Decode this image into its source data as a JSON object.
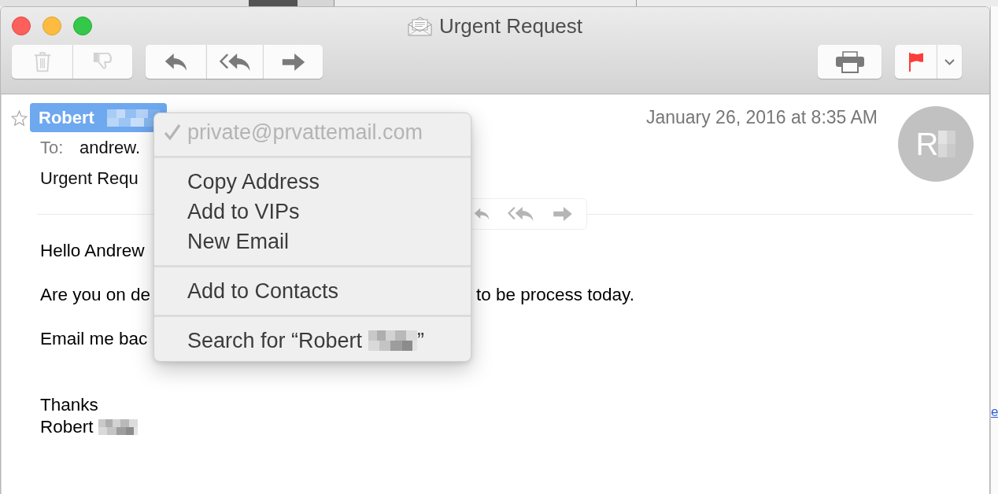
{
  "window": {
    "title": "Urgent Request"
  },
  "toolbar": {
    "left": [
      {
        "buttons": [
          {
            "kind": "trash",
            "disabled": true
          },
          {
            "kind": "junk",
            "disabled": true
          }
        ]
      },
      {
        "buttons": [
          {
            "kind": "reply",
            "disabled": false
          },
          {
            "kind": "reply_all",
            "disabled": false
          },
          {
            "kind": "forward",
            "disabled": false
          }
        ]
      }
    ],
    "right": [
      {
        "buttons": [
          {
            "kind": "print",
            "disabled": false
          }
        ]
      },
      {
        "buttons": [
          {
            "kind": "flag",
            "disabled": false
          },
          {
            "kind": "menu",
            "disabled": false
          }
        ]
      }
    ]
  },
  "message": {
    "sender": {
      "name": "Robert",
      "redacted": true,
      "selected": true,
      "vip": false
    },
    "date": "January 26, 2016 at 8:35 AM",
    "to_label": "To:",
    "to": "andrew.",
    "subject": "Urgent Requ",
    "avatar": {
      "initial": "R",
      "redacted": true
    },
    "quick_actions": [
      {
        "kind": "reply"
      },
      {
        "kind": "reply_all"
      },
      {
        "kind": "forward"
      }
    ],
    "body": [
      {
        "text": "Hello Andrew"
      },
      {
        "text": "Are you on de",
        "text_after": "to be process today."
      },
      {
        "text": "Email me bac"
      }
    ],
    "closing": "Thanks",
    "signature": {
      "name": "Robert",
      "redacted": true
    }
  },
  "context_menu": {
    "groups": [
      {
        "items": [
          {
            "label": "private@prvattemail.com",
            "checked": true,
            "disabled": true
          }
        ]
      },
      {
        "items": [
          {
            "label": "Copy Address",
            "checked": false,
            "disabled": false
          },
          {
            "label": "Add to VIPs",
            "checked": false,
            "disabled": false
          },
          {
            "label": "New Email",
            "checked": false,
            "disabled": false
          }
        ]
      },
      {
        "items": [
          {
            "label": "Add to Contacts",
            "checked": false,
            "disabled": false
          }
        ]
      },
      {
        "items": [
          {
            "label": "Search for “Robert",
            "redacted": true,
            "label_end": "”",
            "checked": false,
            "disabled": false
          }
        ]
      }
    ]
  },
  "background_window": {
    "link": "e"
  }
}
